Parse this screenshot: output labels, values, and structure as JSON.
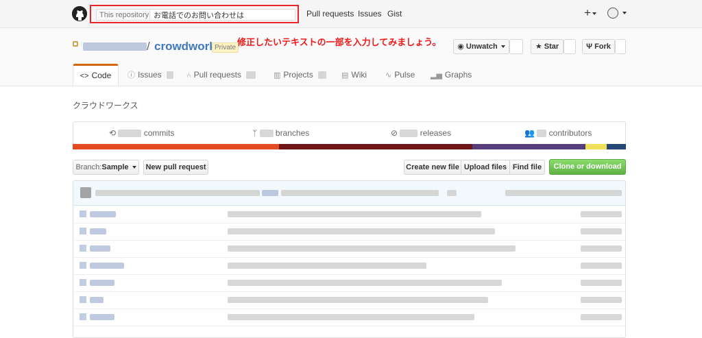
{
  "header": {
    "search_scope": "This repository",
    "search_value": "お電話でのお問い合わせは",
    "nav": [
      "Pull requests",
      "Issues",
      "Gist"
    ],
    "plus_label": "+"
  },
  "repo": {
    "name": "crowdworks",
    "separator": "/",
    "private_badge": "Private",
    "annotation": "修正したいテキストの一部を入力してみましょう。",
    "actions": {
      "watch_label": "Unwatch",
      "star_label": "Star",
      "fork_label": "Fork"
    }
  },
  "tabs": [
    {
      "label": "Code",
      "icon": "code-icon"
    },
    {
      "label": "Issues",
      "icon": "issue-opened-icon"
    },
    {
      "label": "Pull requests",
      "icon": "git-pull-request-icon"
    },
    {
      "label": "Projects",
      "icon": "project-icon"
    },
    {
      "label": "Wiki",
      "icon": "book-icon"
    },
    {
      "label": "Pulse",
      "icon": "pulse-icon"
    },
    {
      "label": "Graphs",
      "icon": "graph-icon"
    }
  ],
  "description": "クラウドワークス",
  "summary": {
    "commits": "commits",
    "branches": "branches",
    "releases": "releases",
    "contributors": "contributors"
  },
  "language_colors": [
    "#e44b23",
    "#701516",
    "#563d7c",
    "#f1e05a",
    "#244776"
  ],
  "toolbar": {
    "branch_prefix": "Branch:",
    "branch_name": "Sample",
    "new_pr": "New pull request",
    "create_file": "Create new file",
    "upload_files": "Upload files",
    "find_file": "Find file",
    "clone": "Clone or download"
  }
}
